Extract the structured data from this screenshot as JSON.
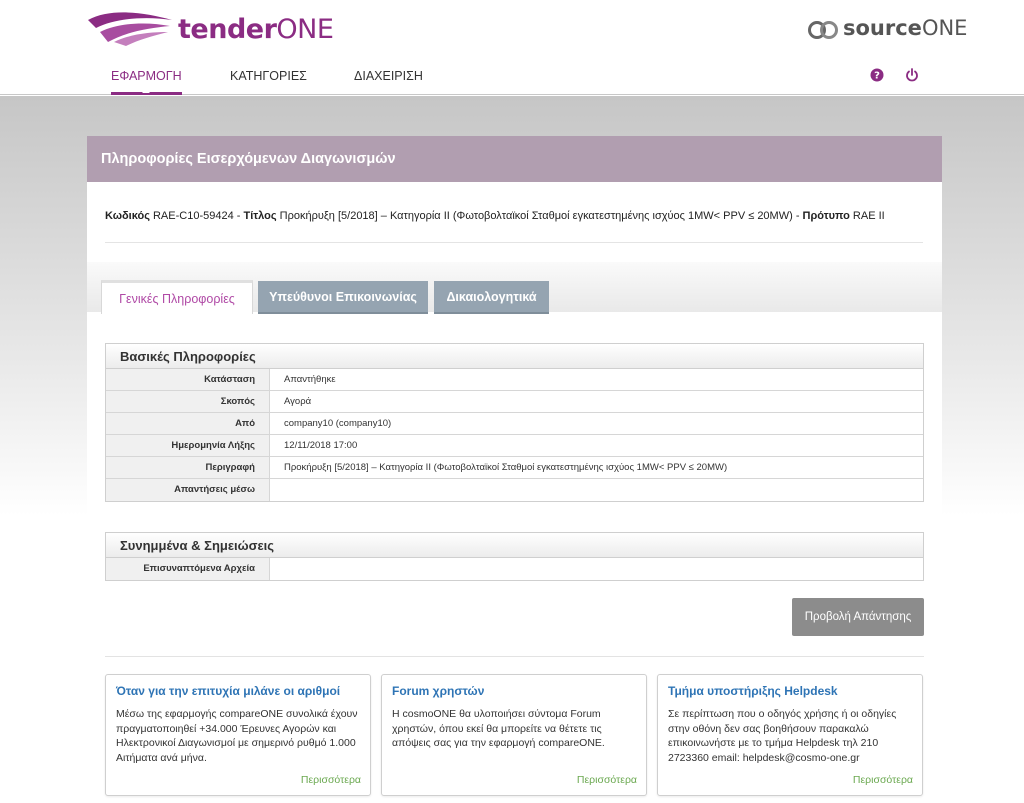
{
  "header": {
    "logo_left_bold": "tender",
    "logo_left_rest": "ONE",
    "logo_right_bold": "source",
    "logo_right_rest": "ONE",
    "nav": [
      {
        "label": "ΕΦΑΡΜΟΓΗ",
        "active": true
      },
      {
        "label": "ΚΑΤΗΓΟΡΙΕΣ",
        "active": false
      },
      {
        "label": "ΔΙΑΧΕΙΡΙΣΗ",
        "active": false
      }
    ],
    "icons": [
      "help-icon",
      "power-icon"
    ]
  },
  "colors": {
    "brand": "#8b2c83",
    "panel_title": "#b19eb0",
    "tab_inactive": "#95a4b1",
    "link": "#2e74b5",
    "more": "#6aa84f"
  },
  "panel": {
    "title": "Πληροφορίες Εισερχόμενων Διαγωνισμών",
    "code_label": "Κωδικός",
    "code_value": "RAE-C10-59424",
    "title_label": "Τίτλος",
    "title_value": "Προκήρυξη [5/2018] – Κατηγορία ΙΙ (Φωτοβολταϊκοί Σταθμοί εγκατεστημένης ισχύος 1MW< PPV ≤ 20MW)",
    "template_label": "Πρότυπο",
    "template_value": "RAE II",
    "sep": " - "
  },
  "tabs": [
    {
      "label": "Γενικές Πληροφορίες",
      "active": true
    },
    {
      "label": "Υπεύθυνοι Επικοινωνίας",
      "active": false
    },
    {
      "label": "Δικαιολογητικά",
      "active": false
    }
  ],
  "basic_info": {
    "title": "Βασικές Πληροφορίες",
    "rows": [
      {
        "k": "Κατάσταση",
        "v": "Απαντήθηκε"
      },
      {
        "k": "Σκοπός",
        "v": "Αγορά"
      },
      {
        "k": "Από",
        "v": "company10 (company10)"
      },
      {
        "k": "Ημερομηνία Λήξης",
        "v": "12/11/2018 17:00"
      },
      {
        "k": "Περιγραφή",
        "v": "Προκήρυξη [5/2018] – Κατηγορία ΙΙ (Φωτοβολταϊκοί Σταθμοί εγκατεστημένης ισχύος 1MW< PPV ≤ 20MW)"
      },
      {
        "k": "Απαντήσεις μέσω",
        "v": ""
      }
    ]
  },
  "attachments": {
    "title": "Συνημμένα & Σημειώσεις",
    "rows": [
      {
        "k": "Επισυναπτόμενα Αρχεία",
        "v": ""
      }
    ]
  },
  "actions": {
    "view_response": "Προβολή Απάντησης"
  },
  "cards": [
    {
      "title": "Όταν για την επιτυχία μιλάνε οι αριθμοί",
      "body": "Μέσω της εφαρμογής compareONE συνολικά έχουν πραγματοποιηθεί +34.000 Έρευνες Αγορών και Ηλεκτρονικοί Διαγωνισμοί με σημερινό ρυθμό 1.000 Αιτήματα ανά μήνα.",
      "more": "Περισσότερα"
    },
    {
      "title": "Forum χρηστών",
      "body": "Η cosmoONE θα υλοποιήσει σύντομα Forum χρηστών, όπου εκεί θα μπορείτε να θέτετε τις απόψεις σας για την εφαρμογή compareONE.",
      "more": "Περισσότερα"
    },
    {
      "title": "Τμήμα υποστήριξης Helpdesk",
      "body": "Σε περίπτωση που ο οδηγός χρήσης ή οι οδηγίες στην οθόνη δεν σας βοηθήσουν παρακαλώ επικοινωνήστε με το τμήμα Helpdesk τηλ 210 2723360 email: helpdesk@cosmo-one.gr",
      "more": "Περισσότερα"
    }
  ]
}
